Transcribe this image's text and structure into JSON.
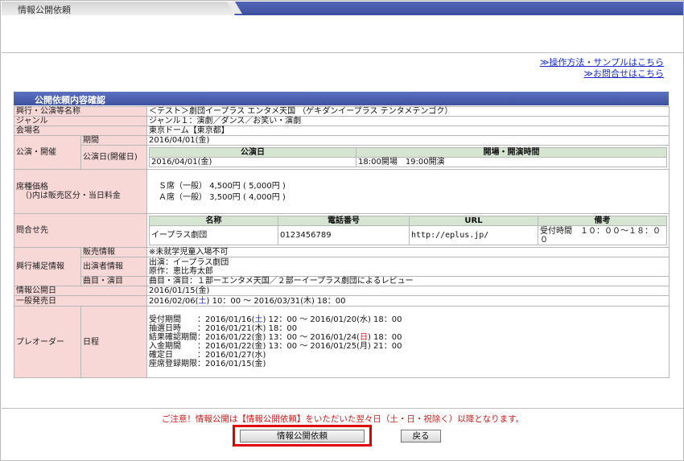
{
  "window": {
    "title": "情報公開依頼"
  },
  "help_links": [
    "≫操作方法・サンプルはこちら",
    "≫お問合せはこちら"
  ],
  "section_title": "公開依頼内容確認",
  "rows": {
    "performance_name": {
      "label": "興行・公演等名称",
      "value": "＜テスト＞劇団イープラス エンタメ天国 （ゲキダンイープラス テンタメテンゴク）"
    },
    "genre": {
      "label": "ジャンル",
      "value": "ジャンル１：演劇／ダンス／お笑い・演劇"
    },
    "venue": {
      "label": "会場名",
      "value": "東京ドーム【東京都】"
    },
    "schedule": {
      "label": "公演・開催",
      "period_label": "期間",
      "period_value": "2016/04/01(金)",
      "date_label": "公演日(開催日)",
      "date_headers": [
        "公演日",
        "開場・開演時間"
      ],
      "date_row": [
        "2016/04/01(金)",
        "18:00開場　19:00開演"
      ]
    },
    "seat_price": {
      "label": "席種価格",
      "sublabel": "（)内は販売区分・当日料金",
      "lines": [
        "Ｓ席（一般） 4,500円 ( 5,000円 )",
        "Ａ席（一般） 3,500円 ( 4,000円 )"
      ]
    },
    "contact": {
      "label": "問合せ先",
      "headers": [
        "名称",
        "電話番号",
        "URL",
        "備考"
      ],
      "row": [
        "イープラス劇団",
        "0123456789",
        "http://eplus.jp/",
        "受付時間　１０：００～１８：００"
      ]
    },
    "supplement": {
      "label": "興行補足情報",
      "items": [
        {
          "label": "販売情報",
          "value": "※未就学児童入場不可"
        },
        {
          "label": "出演者情報",
          "value_lines": [
            "出演：イープラス劇団",
            "原作：恵比寿太郎"
          ]
        },
        {
          "label": "曲目・演目",
          "value": "曲目・演目：１部ーエンタメ天国／２部ーイープラス劇団によるレビュー"
        }
      ]
    },
    "info_release": {
      "label": "情報公開日",
      "value": "2016/01/15(金)"
    },
    "general_sale": {
      "label": "一般発売日",
      "value_pre": "2016/02/06(",
      "value_day": "土",
      "value_post": ") 10：00 ～ 2016/03/31(木) 18：00"
    },
    "preorder": {
      "label": "プレオーダー",
      "sub_label": "日程",
      "lines": [
        {
          "pre": "受付期間　　：2016/01/16(",
          "day": "土",
          "day_color": "blue",
          "post": ") 12：00 ～ 2016/01/20(水) 18：00"
        },
        {
          "pre": "抽選日時　　：2016/01/21(木) 18：00",
          "day": "",
          "day_color": "",
          "post": ""
        },
        {
          "pre": "結果確認期間：2016/01/22(金) 13：00 ～ 2016/01/24(",
          "day": "日",
          "day_color": "red",
          "post": ") 18：00"
        },
        {
          "pre": "入金期間　　：2016/01/22(金) 13：00 ～ 2016/01/25(月) 21：00",
          "day": "",
          "day_color": "",
          "post": ""
        },
        {
          "pre": "確定日　　　：2016/01/27(水)",
          "day": "",
          "day_color": "",
          "post": ""
        },
        {
          "pre": "座席登録期限：2016/01/15(金)",
          "day": "",
          "day_color": "",
          "post": ""
        }
      ]
    }
  },
  "notice": "ご注意！情報公開は【情報公開依頼】をいただいた翌々日（土・日・祝除く）以降となります。",
  "buttons": {
    "request": "情報公開依頼",
    "back": "戻る"
  },
  "colors": {
    "label_bg": "#f8d7d7",
    "header_blue": "#3e519f",
    "inner_header_green": "#d6e4d2",
    "link_blue": "#1a2ccf",
    "notice_red": "#d21818",
    "highlight_red": "#e00000"
  }
}
